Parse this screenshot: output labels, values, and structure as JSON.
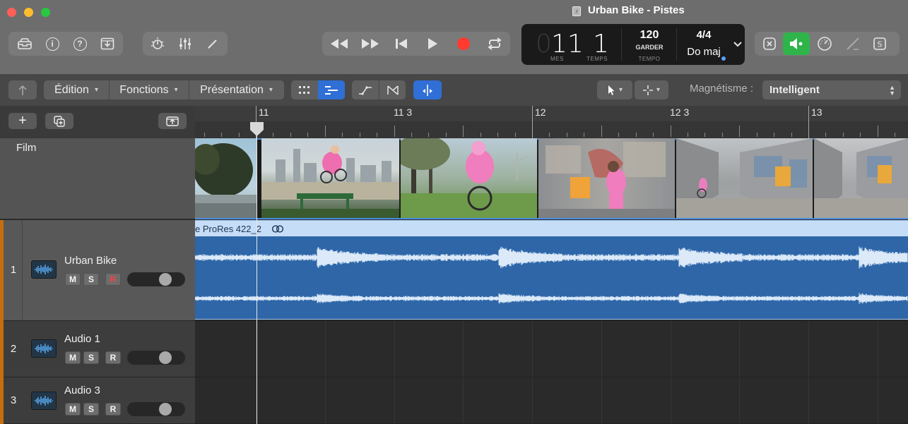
{
  "window": {
    "title": "Urban Bike - Pistes",
    "traffic_lights": {
      "close": "#ff5f57",
      "minimize": "#febc2e",
      "zoom": "#28c840"
    }
  },
  "control_bar": {
    "left_icons": [
      "library-icon",
      "inspector-icon",
      "help-icon",
      "download-icon"
    ],
    "mid_icons": [
      "smart-controls-icon",
      "mixer-icon",
      "editors-icon"
    ],
    "transport_icons": [
      "rewind-icon",
      "fast-forward-icon",
      "go-to-start-icon",
      "play-icon",
      "record-icon",
      "cycle-icon"
    ],
    "right_icons": [
      "count-in-icon",
      "metronome-icon",
      "tuner-icon",
      "pencil-icon",
      "score-icon"
    ],
    "record_color": "#ff3b30",
    "metronome_color": "#2fb44a"
  },
  "lcd": {
    "bar_ghost": "0",
    "bar": "11",
    "beat": "1",
    "bar_label": "MES",
    "beat_label": "TEMPS",
    "tempo": "120",
    "tempo_mode": "GARDER",
    "tempo_label": "TEMPO",
    "time_signature": "4/4",
    "key": "Do maj"
  },
  "local_toolbar": {
    "edit_menu": "Édition",
    "functions_menu": "Fonctions",
    "view_menu": "Présentation",
    "snap_label": "Magnétisme :",
    "snap_value": "Intelligent",
    "accent": "#2f6fd6"
  },
  "ruler": {
    "labels": [
      "11",
      "11 3",
      "12",
      "12 3",
      "13"
    ]
  },
  "film_track": {
    "name": "Film"
  },
  "tracks": [
    {
      "number": "1",
      "name": "Urban Bike",
      "mute": "M",
      "solo": "S",
      "record": "R",
      "selected": true,
      "record_armed_color": "#ff4040"
    },
    {
      "number": "2",
      "name": "Audio 1",
      "mute": "M",
      "solo": "S",
      "record": "R",
      "selected": false
    },
    {
      "number": "3",
      "name": "Audio 3",
      "mute": "M",
      "solo": "S",
      "record": "R",
      "selected": false
    }
  ],
  "region": {
    "name": "e ProRes 422_2",
    "color": "#2e66a8"
  }
}
